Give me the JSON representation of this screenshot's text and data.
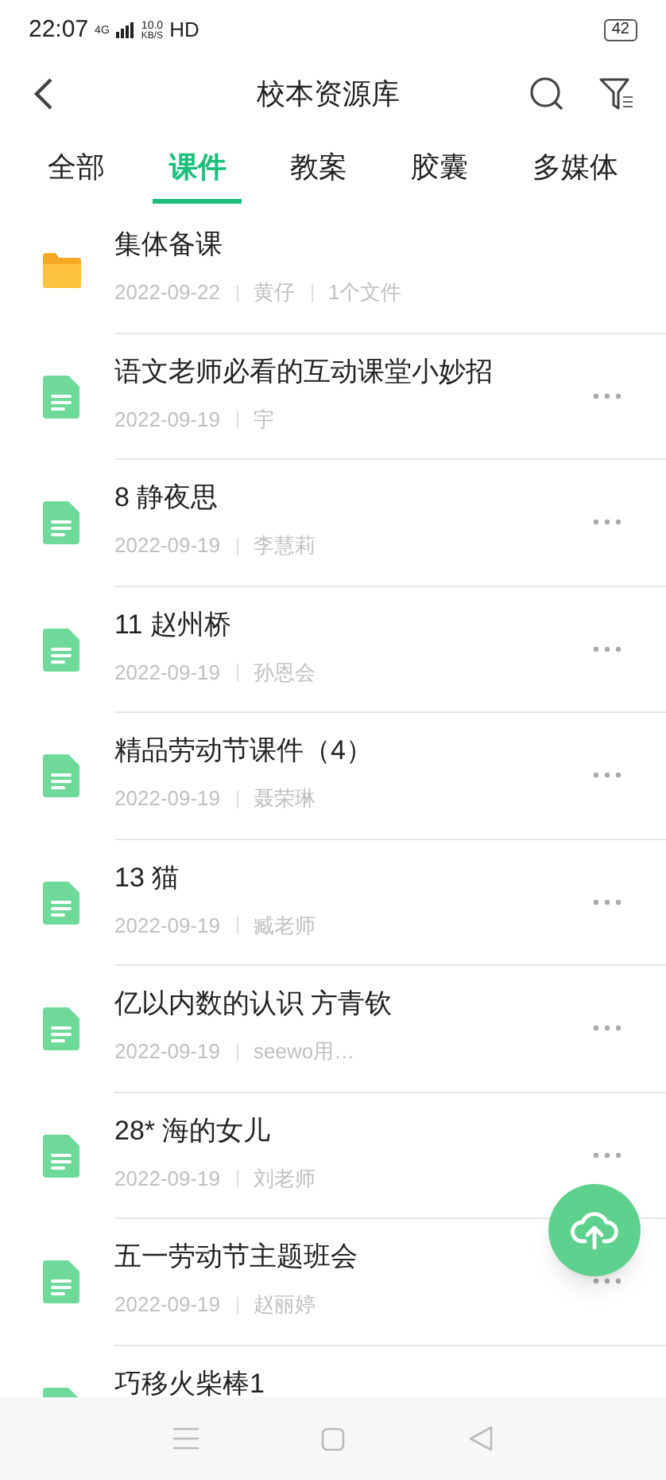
{
  "status_bar": {
    "time": "22:07",
    "network": "4G",
    "speed_value": "10.0",
    "speed_unit": "KB/S",
    "hd": "HD",
    "battery": "42"
  },
  "header": {
    "title": "校本资源库"
  },
  "tabs": [
    {
      "label": "全部",
      "selected": false
    },
    {
      "label": "课件",
      "selected": true
    },
    {
      "label": "教案",
      "selected": false
    },
    {
      "label": "胶囊",
      "selected": false
    },
    {
      "label": "多媒体",
      "selected": false
    }
  ],
  "items": [
    {
      "kind": "folder",
      "title": "集体备课",
      "meta": [
        "2022-09-22",
        "黄仔",
        "1个文件"
      ]
    },
    {
      "kind": "file",
      "title": "语文老师必看的互动课堂小妙招",
      "meta": [
        "2022-09-19",
        "宇"
      ]
    },
    {
      "kind": "file",
      "title": "8 静夜思",
      "meta": [
        "2022-09-19",
        "李慧莉"
      ]
    },
    {
      "kind": "file",
      "title": "11 赵州桥",
      "meta": [
        "2022-09-19",
        "孙恩会"
      ]
    },
    {
      "kind": "file",
      "title": "精品劳动节课件（4）",
      "meta": [
        "2022-09-19",
        "聂荣琳"
      ]
    },
    {
      "kind": "file",
      "title": "13 猫",
      "meta": [
        "2022-09-19",
        "臧老师"
      ]
    },
    {
      "kind": "file",
      "title": "亿以内数的认识 方青钦",
      "meta": [
        "2022-09-19",
        "seewo用…"
      ]
    },
    {
      "kind": "file",
      "title": "28* 海的女儿",
      "meta": [
        "2022-09-19",
        "刘老师"
      ]
    },
    {
      "kind": "file",
      "title": "五一劳动节主题班会",
      "meta": [
        "2022-09-19",
        "赵丽婷"
      ]
    },
    {
      "kind": "file",
      "title": "巧移火柴棒1"
    }
  ]
}
